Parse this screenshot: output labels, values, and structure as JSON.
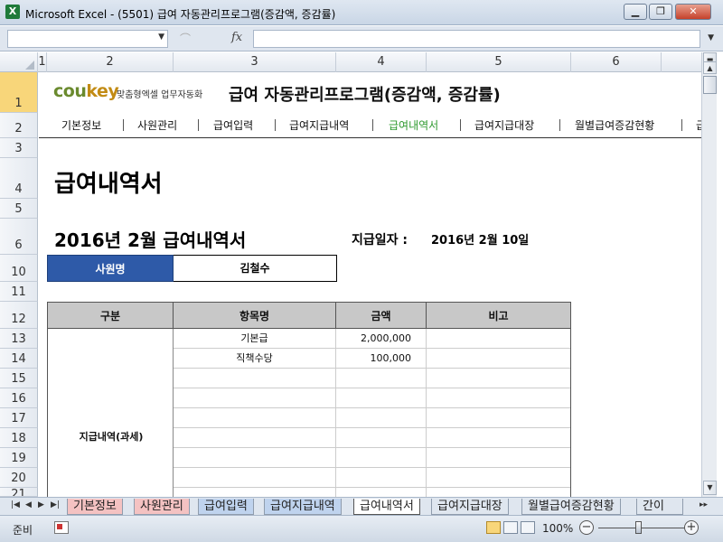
{
  "window": {
    "title": "Microsoft Excel - (5501) 급여 자동관리프로그램(증감액, 증감률)",
    "app_icon": "X",
    "minimize": "▁",
    "restore": "❐",
    "close": "✕"
  },
  "formula_bar": {
    "name_box": "",
    "fx": "fx",
    "formula": ""
  },
  "columns": [
    "1",
    "2",
    "3",
    "4",
    "5",
    "6"
  ],
  "rows": [
    "1",
    "2",
    "3",
    "4",
    "5",
    "6",
    "10",
    "11",
    "12",
    "13",
    "14",
    "15",
    "16",
    "17",
    "18",
    "19",
    "20",
    "21"
  ],
  "header": {
    "logo_main": "cou",
    "logo_key": "key",
    "logo_sub": "맞춤형엑셀 업무자동화",
    "app_title": "급여 자동관리프로그램(증감액, 증감률)"
  },
  "nav": {
    "items": [
      "기본정보",
      "사원관리",
      "급여입력",
      "급여지급내역",
      "급여내역서",
      "급여지급대장",
      "월별급여증감현황",
      "급"
    ],
    "active": "급여내역서"
  },
  "page": {
    "title": "급여내역서",
    "period_title": "2016년 2월  급여내역서",
    "pay_date_label": "지급일자 :",
    "pay_date_value": "2016년 2월 10일"
  },
  "employee": {
    "label": "사원명",
    "value": "김철수"
  },
  "table": {
    "headers": [
      "구분",
      "항목명",
      "금액",
      "비고"
    ],
    "category": "지급내역(과세)",
    "rows": [
      {
        "name": "기본급",
        "amount": "2,000,000",
        "note": ""
      },
      {
        "name": "직책수당",
        "amount": "100,000",
        "note": ""
      },
      {
        "name": "",
        "amount": "",
        "note": ""
      },
      {
        "name": "",
        "amount": "",
        "note": ""
      },
      {
        "name": "",
        "amount": "",
        "note": ""
      },
      {
        "name": "",
        "amount": "",
        "note": ""
      },
      {
        "name": "",
        "amount": "",
        "note": ""
      },
      {
        "name": "",
        "amount": "",
        "note": ""
      },
      {
        "name": "",
        "amount": "",
        "note": ""
      }
    ]
  },
  "sheet_tabs": {
    "items": [
      "기본정보",
      "사원관리",
      "급여입력",
      "급여지급내역",
      "급여내역서",
      "급여지급대장",
      "월별급여증감현황",
      "간이"
    ],
    "active": "급여내역서",
    "colors": [
      "#f4c2c2",
      "#f4c2c2",
      "#bfd3ee",
      "#bfd3ee",
      "#ffffff",
      "#dfe6ef",
      "#dfe6ef",
      "#dfe6ef"
    ]
  },
  "status": {
    "ready": "준비",
    "zoom": "100%",
    "zoom_fraction": 0.5
  },
  "colors": {
    "accent": "#2e5aa8",
    "nav_active": "#2e9a2e",
    "table_header": "#c8c8c8",
    "logo_green": "#6a8a2e",
    "logo_gold": "#c28b14"
  }
}
